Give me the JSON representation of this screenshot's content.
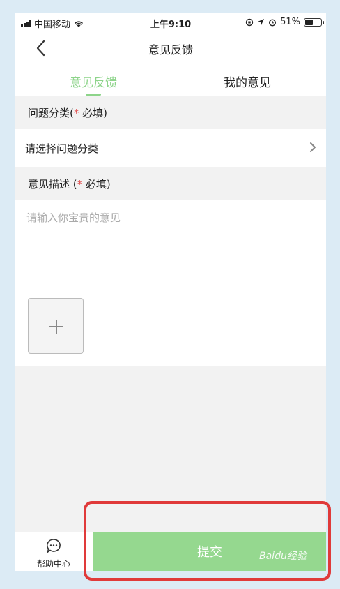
{
  "status_bar": {
    "carrier": "中国移动",
    "time": "上午9:10",
    "battery": "51%",
    "battery_level": 0.51
  },
  "nav": {
    "title": "意见反馈"
  },
  "tabs": [
    {
      "label": "意见反馈",
      "active": true
    },
    {
      "label": "我的意见",
      "active": false
    }
  ],
  "category_section": {
    "label_prefix": "问题分类(",
    "required_star": "*",
    "required_text": " 必填)"
  },
  "category_row": {
    "label": "请选择问题分类"
  },
  "description_section": {
    "label_prefix": "意见描述 (",
    "required_star": "*",
    "required_text": " 必填)"
  },
  "description": {
    "value": "",
    "placeholder": "请输入你宝贵的意见"
  },
  "bottom": {
    "help_label": "帮助中心",
    "submit_label": "提交"
  },
  "watermark": {
    "text": "Baidu经验"
  },
  "colors": {
    "accent": "#8dd48a",
    "submit": "#95d88f",
    "required": "#e05050",
    "highlight": "#e03a3a"
  }
}
